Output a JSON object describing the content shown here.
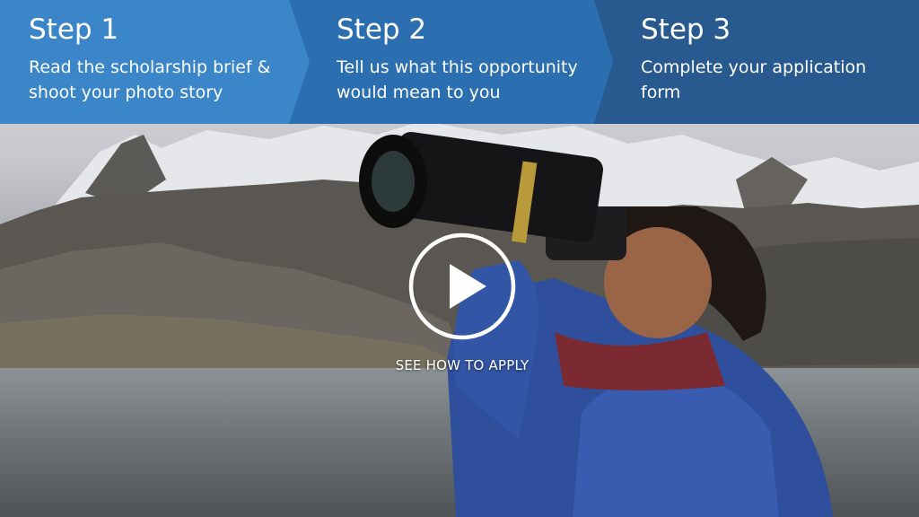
{
  "steps": [
    {
      "title": "Step 1",
      "description": "Read the scholarship brief & shoot your photo story"
    },
    {
      "title": "Step 2",
      "description": "Tell us what this opportunity would mean to you"
    },
    {
      "title": "Step 3",
      "description": "Complete your application form"
    }
  ],
  "video": {
    "cta_label": "SEE HOW TO APPLY",
    "play_icon": "play-circle-icon"
  },
  "colors": {
    "step_1": "#3a86c8",
    "step_2": "#2b6fb0",
    "step_3": "#285a8f",
    "text": "#ffffff"
  }
}
